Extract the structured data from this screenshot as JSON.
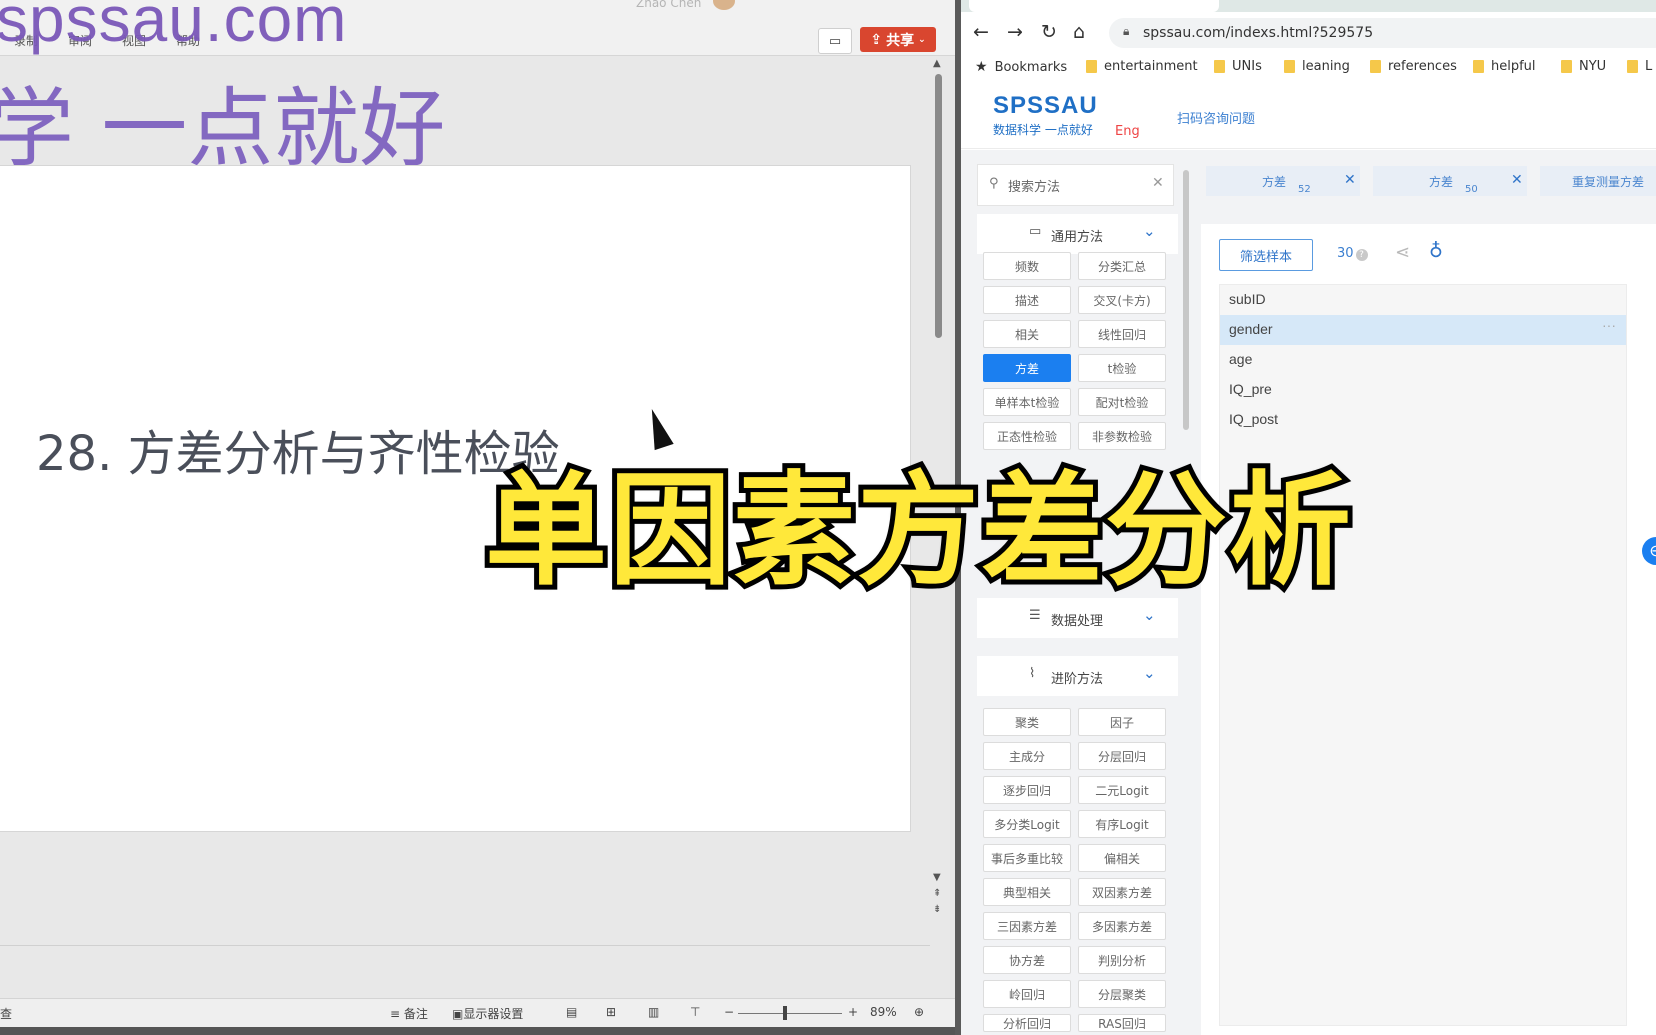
{
  "ppt": {
    "user_name": "Zhao Chen",
    "menu": [
      "录制",
      "审阅",
      "视图",
      "帮助"
    ],
    "comment_icon": "comment-icon",
    "share_label": "共享",
    "watermark_url": "spssau.com",
    "watermark_slogan": "学 一点就好",
    "slide_title": "28. 方差分析与齐性检验",
    "status": {
      "left": "查",
      "notes": "备注",
      "display": "显示器设置",
      "zoom_minus": "−",
      "zoom_plus": "+",
      "zoom": "89%"
    }
  },
  "browser": {
    "url": "spssau.com/indexs.html?529575",
    "bookmarks": [
      "Bookmarks",
      "entertainment",
      "UNIs",
      "leaning",
      "references",
      "helpful",
      "NYU",
      "L"
    ],
    "site": {
      "logo": "SPSSAU",
      "slogan": "数据科学 一点就好",
      "lang": "Eng",
      "consult": "扫码咨询问题"
    },
    "sidebar": {
      "search_placeholder": "搜索方法",
      "sections": {
        "general": "通用方法",
        "data": "数据处理",
        "advanced": "进阶方法"
      },
      "general_methods": [
        "频数",
        "分类汇总",
        "描述",
        "交叉(卡方)",
        "相关",
        "线性回归",
        "方差",
        "t检验",
        "单样本t检验",
        "配对t检验",
        "正态性检验",
        "非参数检验"
      ],
      "active_method": "方差",
      "advanced_methods": [
        "聚类",
        "因子",
        "主成分",
        "分层回归",
        "逐步回归",
        "二元Logit",
        "多分类Logit",
        "有序Logit",
        "事后多重比较",
        "偏相关",
        "典型相关",
        "双因素方差",
        "三因素方差",
        "多因素方差",
        "协方差",
        "判别分析",
        "岭回归",
        "分层聚类",
        "分析回归",
        "RAS回归"
      ]
    },
    "chips": [
      {
        "label": "方差",
        "num": "52"
      },
      {
        "label": "方差",
        "num": "50"
      },
      {
        "label": "重复测量方差",
        "num": ""
      }
    ],
    "filter_button": "筛选样本",
    "sample_count": "30",
    "variables": [
      "subID",
      "gender",
      "age",
      "IQ_pre",
      "IQ_post"
    ],
    "selected_variable": "gender"
  },
  "caption": "单因素方差分析"
}
